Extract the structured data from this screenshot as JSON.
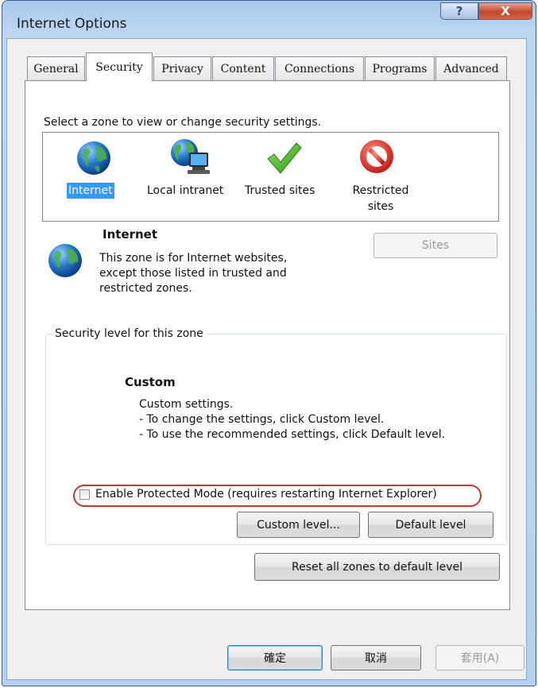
{
  "window": {
    "title": "Internet Options",
    "help_glyph": "?",
    "close_glyph": "X"
  },
  "tabs": [
    {
      "label": "General"
    },
    {
      "label": "Security",
      "active": true
    },
    {
      "label": "Privacy"
    },
    {
      "label": "Content"
    },
    {
      "label": "Connections"
    },
    {
      "label": "Programs"
    },
    {
      "label": "Advanced"
    }
  ],
  "security": {
    "zone_prompt": "Select a zone to view or change security settings.",
    "zones": [
      {
        "label": "Internet",
        "icon": "globe-icon",
        "selected": true
      },
      {
        "label": "Local intranet",
        "icon": "local-intranet-icon"
      },
      {
        "label": "Trusted sites",
        "icon": "checkmark-icon"
      },
      {
        "label_line1": "Restricted",
        "label_line2": "sites",
        "icon": "restricted-icon"
      }
    ],
    "zone_info": {
      "name": "Internet",
      "desc_line1": "This zone is for Internet websites,",
      "desc_line2": "except those listed in trusted and",
      "desc_line3": "restricted zones."
    },
    "sites_button": "Sites",
    "level_group": {
      "caption": "Security level for this zone",
      "level_name": "Custom",
      "line1": "Custom settings.",
      "line2": "- To change the settings, click Custom level.",
      "line3": "- To use the recommended settings, click Default level."
    },
    "protected_mode": {
      "label": "Enable Protected Mode (requires restarting Internet Explorer)",
      "checked": false
    },
    "custom_level_button": "Custom level...",
    "default_level_button": "Default level",
    "reset_all_button": "Reset all zones to default level"
  },
  "footer": {
    "ok": "確定",
    "cancel": "取消",
    "apply": "套用(A)"
  },
  "colors": {
    "selection": "#3399ff",
    "highlight_ring": "#c0392b",
    "titlebar": "#b6d1ef"
  }
}
